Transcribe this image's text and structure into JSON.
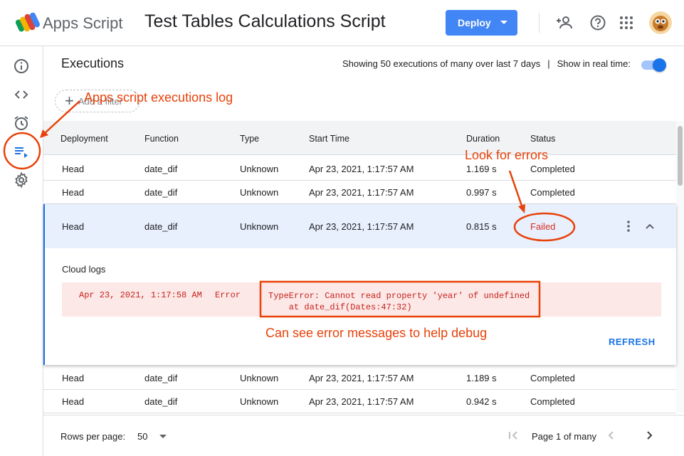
{
  "header": {
    "app_name": "Apps Script",
    "project_title": "Test Tables Calculations Script",
    "deploy_label": "Deploy",
    "icons": [
      "add-person-icon",
      "help-icon",
      "apps-grid-icon",
      "avatar"
    ]
  },
  "rail": {
    "items": [
      "info-icon",
      "code-icon",
      "alarm-icon",
      "executions-icon",
      "settings-icon"
    ],
    "active": "executions-icon"
  },
  "executions": {
    "title": "Executions",
    "showing_text": "Showing 50 executions of many over last 7 days",
    "separator": "|",
    "realtime_label": "Show in real time:",
    "realtime_on": true,
    "add_filter_label": "Add a filter"
  },
  "table": {
    "columns": [
      "Deployment",
      "Function",
      "Type",
      "Start Time",
      "Duration",
      "Status"
    ],
    "rows": [
      {
        "deployment": "Head",
        "function": "date_dif",
        "type": "Unknown",
        "start_time": "Apr 23, 2021, 1:17:57 AM",
        "duration": "1.169 s",
        "status": "Completed"
      },
      {
        "deployment": "Head",
        "function": "date_dif",
        "type": "Unknown",
        "start_time": "Apr 23, 2021, 1:17:57 AM",
        "duration": "0.997 s",
        "status": "Completed"
      },
      {
        "deployment": "Head",
        "function": "date_dif",
        "type": "Unknown",
        "start_time": "Apr 23, 2021, 1:17:57 AM",
        "duration": "0.815 s",
        "status": "Failed"
      },
      {
        "deployment": "Head",
        "function": "date_dif",
        "type": "Unknown",
        "start_time": "Apr 23, 2021, 1:17:57 AM",
        "duration": "1.189 s",
        "status": "Completed"
      },
      {
        "deployment": "Head",
        "function": "date_dif",
        "type": "Unknown",
        "start_time": "Apr 23, 2021, 1:17:57 AM",
        "duration": "0.942 s",
        "status": "Completed"
      }
    ],
    "expanded": {
      "cloud_logs_label": "Cloud logs",
      "log_time": "Apr 23, 2021, 1:17:58 AM",
      "log_level": "Error",
      "log_message": "TypeError: Cannot read property 'year' of undefined\n    at date_dif(Dates:47:32)",
      "refresh_label": "REFRESH"
    }
  },
  "footer": {
    "rows_per_page_label": "Rows per page:",
    "rows_per_page_value": "50",
    "page_info": "Page 1 of many"
  },
  "annotations": {
    "log_note": "Apps script executions log",
    "errors_note": "Look for errors",
    "debug_note": "Can see error messages to help debug",
    "color": "#e8420a"
  },
  "colors": {
    "accent": "#1a73e8",
    "deploy": "#4285f4",
    "error": "#d93025"
  }
}
